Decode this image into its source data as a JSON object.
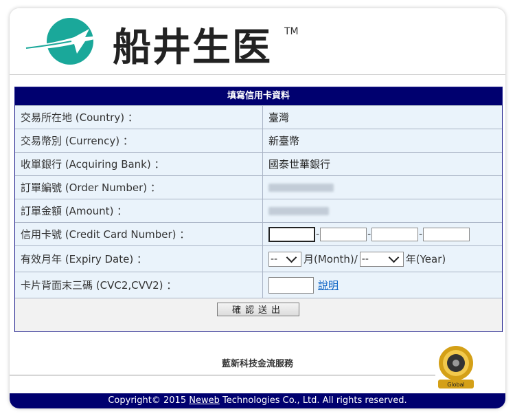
{
  "brand": {
    "name": "船井生医",
    "tm": "TM"
  },
  "form": {
    "title": "填寫信用卡資料",
    "rows": [
      {
        "label": "交易所在地 (Country) ：",
        "value": "臺灣"
      },
      {
        "label": "交易幣別 (Currency) ：",
        "value": "新臺幣"
      },
      {
        "label": "收單銀行 (Acquiring Bank) ：",
        "value": "國泰世華銀行"
      },
      {
        "label": "訂單編號 (Order Number) ：",
        "value": ""
      },
      {
        "label": "訂單金額 (Amount) ：",
        "value": ""
      },
      {
        "label": "信用卡號 (Credit Card Number) ："
      },
      {
        "label": "有效月年 (Expiry Date) ："
      },
      {
        "label": "卡片背面末三碼 (CVC2,CVV2) ："
      }
    ],
    "card": {
      "dash": "-",
      "part1": "",
      "part2": "",
      "part3": "",
      "part4": ""
    },
    "expiry": {
      "month_value": "--",
      "month_unit": "月(Month)/",
      "year_value": "--",
      "year_unit": "年(Year)"
    },
    "cvc": {
      "value": "",
      "help": "說明"
    },
    "submit": "確認送出"
  },
  "footer": {
    "service": "藍新科技金流服務",
    "copyright_prefix": "Copyright© 2015 ",
    "brand": "Neweb",
    "copyright_suffix": " Technologies Co., Ltd. All rights reserved.",
    "seal_text": "Global"
  },
  "colors": {
    "accent": "#00006f",
    "logo": "#1aa89a"
  }
}
